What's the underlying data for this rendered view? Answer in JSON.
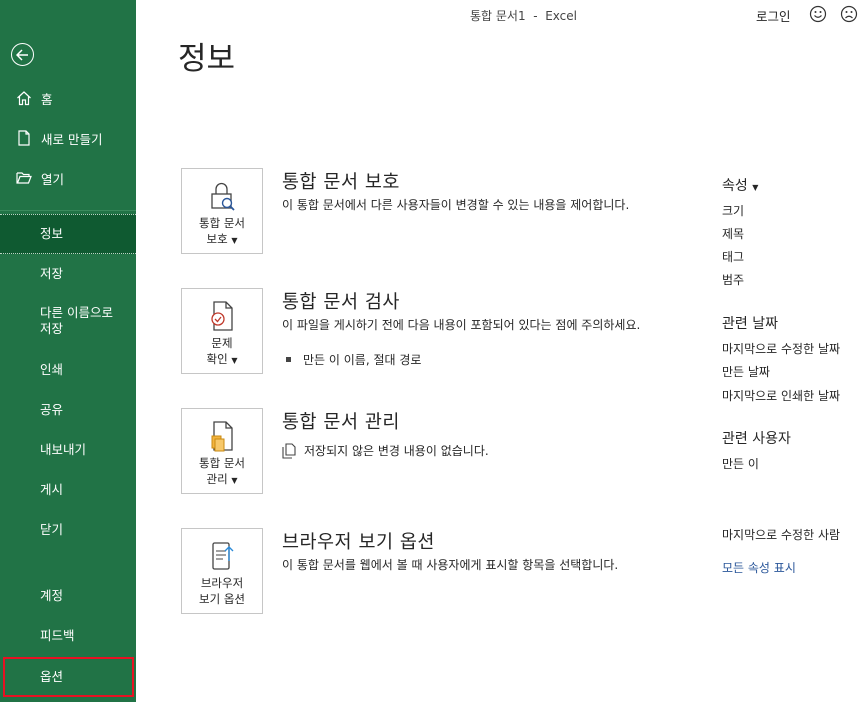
{
  "window": {
    "title": "통합 문서1  -  Excel",
    "signin": "로그인"
  },
  "sidebar": {
    "top_items": [
      {
        "label": "홈",
        "icon": "home-icon"
      },
      {
        "label": "새로 만들기",
        "icon": "new-document-icon"
      },
      {
        "label": "열기",
        "icon": "open-folder-icon"
      }
    ],
    "items": [
      "정보",
      "저장",
      "다른 이름으로\n저장",
      "인쇄",
      "공유",
      "내보내기",
      "게시",
      "닫기"
    ],
    "bottom_items": [
      "계정",
      "피드백",
      "옵션"
    ]
  },
  "page_title": "정보",
  "sections": {
    "protect": {
      "title": "통합 문서 보호",
      "tile_label": "통합 문서\n보호",
      "desc": "이 통합 문서에서 다른 사용자들이 변경할 수 있는 내용을 제어합니다."
    },
    "inspect": {
      "title": "통합 문서 검사",
      "tile_label": "문제\n확인",
      "desc": "이 파일을 게시하기 전에 다음 내용이 포함되어 있다는 점에 주의하세요.",
      "bullet": "만든 이 이름, 절대 경로"
    },
    "manage": {
      "title": "통합 문서 관리",
      "tile_label": "통합 문서\n관리",
      "note": "저장되지 않은 변경 내용이 없습니다."
    },
    "browser": {
      "title": "브라우저 보기 옵션",
      "tile_label": "브라우저\n보기 옵션",
      "desc": "이 통합 문서를 웹에서 볼 때 사용자에게 표시할 항목을 선택합니다."
    }
  },
  "properties": {
    "header": "속성",
    "items": [
      "크기",
      "제목",
      "태그",
      "범주"
    ],
    "dates_header": "관련 날짜",
    "dates": [
      "마지막으로 수정한 날짜",
      "만든 날짜",
      "마지막으로 인쇄한 날짜"
    ],
    "people_header": "관련 사용자",
    "people": [
      "만든 이"
    ],
    "last_modified_by": "마지막으로 수정한 사람",
    "show_all": "모든 속성 표시"
  },
  "colors": {
    "sidebar": "#217346",
    "active": "#0f5a31",
    "highlight": "#e81123",
    "link": "#2b579a"
  }
}
